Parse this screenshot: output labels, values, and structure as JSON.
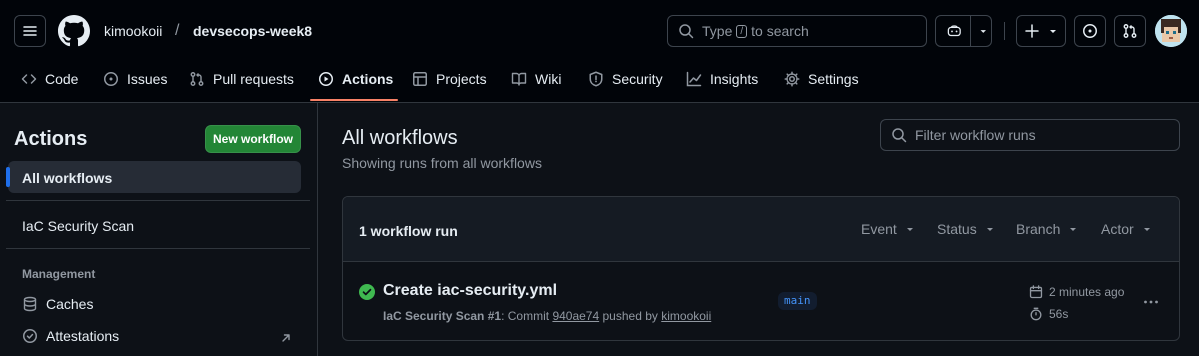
{
  "header": {
    "owner": "kimookoii",
    "separator": "/",
    "repo": "devsecops-week8",
    "search": {
      "prefix": "Type",
      "key": "/",
      "suffix": "to search"
    }
  },
  "nav": {
    "tabs": [
      {
        "label": "Code",
        "icon": "code-icon"
      },
      {
        "label": "Issues",
        "icon": "issue-icon"
      },
      {
        "label": "Pull requests",
        "icon": "pull-request-icon"
      },
      {
        "label": "Actions",
        "icon": "play-icon",
        "active": true
      },
      {
        "label": "Projects",
        "icon": "table-icon"
      },
      {
        "label": "Wiki",
        "icon": "book-icon"
      },
      {
        "label": "Security",
        "icon": "shield-icon"
      },
      {
        "label": "Insights",
        "icon": "graph-icon"
      },
      {
        "label": "Settings",
        "icon": "gear-icon"
      }
    ]
  },
  "sidebar": {
    "title": "Actions",
    "new_workflow": "New workflow",
    "all_workflows": "All workflows",
    "workflows": [
      "IaC Security Scan"
    ],
    "management_label": "Management",
    "management": [
      {
        "label": "Caches",
        "icon": "cache-icon"
      },
      {
        "label": "Attestations",
        "icon": "verified-icon"
      }
    ]
  },
  "main": {
    "title": "All workflows",
    "subtitle": "Showing runs from all workflows",
    "filter_placeholder": "Filter workflow runs",
    "runs_count": "1 workflow run",
    "filters": [
      "Event",
      "Status",
      "Branch",
      "Actor"
    ],
    "runs": [
      {
        "title": "Create iac-security.yml",
        "workflow": "IaC Security Scan",
        "run_number": "#1",
        "commit_prefix": ": Commit",
        "commit": "940ae74",
        "pushed_by": "pushed by",
        "actor": "kimookoii",
        "branch": "main",
        "time": "2 minutes ago",
        "duration": "56s",
        "status": "success"
      }
    ]
  },
  "colors": {
    "accent": "#f78166",
    "success": "#3fb950",
    "primary_button": "#238636",
    "branch": "#4493f8"
  }
}
